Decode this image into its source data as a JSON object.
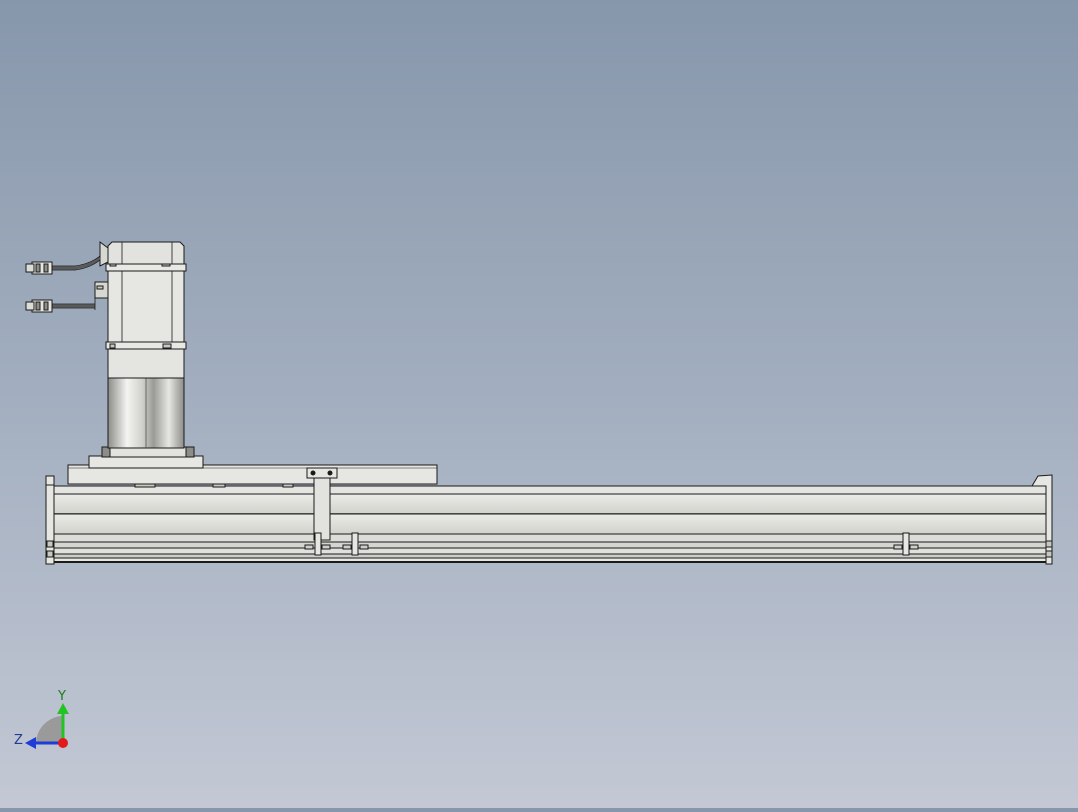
{
  "viewport": {
    "background_top": "#8797ab",
    "background_bottom": "#c3c8d4"
  },
  "model": {
    "part_fill": "#e2e2de",
    "part_shade": "#c8c8c3",
    "edge_color": "#1a1a1a",
    "cylinder_highlight": "#f4f4f2",
    "cylinder_shadow": "#8c8c88",
    "cable_color": "#5a5a5a"
  },
  "triad": {
    "y_label": "Y",
    "z_label": "Z",
    "y_color": "#22c322",
    "z_color": "#1f3cd8",
    "x_color": "#e21a1a",
    "arc_color": "#9a9a9a"
  }
}
